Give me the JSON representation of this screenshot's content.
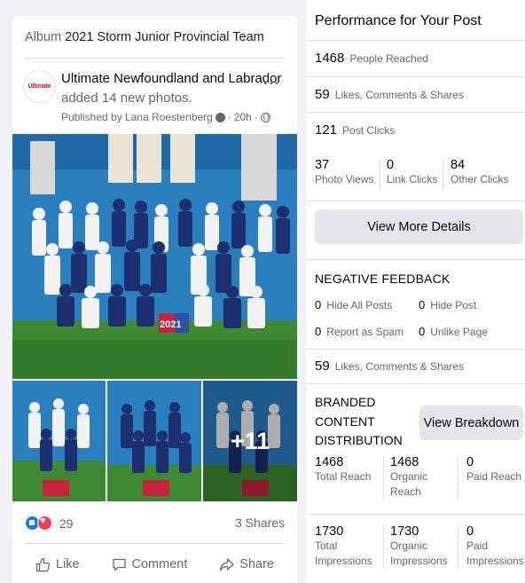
{
  "post": {
    "album_prefix": "Album",
    "album_name": "2021 Storm Junior Provincial Team",
    "avatar_text": "Ultimate",
    "page_name": "Ultimate Newfoundland and Labrador",
    "action_text": "added 14 new photos.",
    "published_by": "Published by Lana Roestenberg",
    "time": "20h",
    "more_photos": "+11",
    "reaction_count": "29",
    "shares": "3 Shares",
    "actions": {
      "like": "Like",
      "comment": "Comment",
      "share": "Share"
    },
    "colors": {
      "like": "#1877f2",
      "love": "#f33e58"
    }
  },
  "panel": {
    "title": "Performance for Your Post",
    "people_reached": {
      "value": "1468",
      "label": "People Reached"
    },
    "engagement": {
      "value": "59",
      "label": "Likes, Comments & Shares"
    },
    "post_clicks": {
      "value": "121",
      "label": "Post Clicks"
    },
    "clicks": [
      {
        "value": "37",
        "label": "Photo Views"
      },
      {
        "value": "0",
        "label": "Link Clicks"
      },
      {
        "value": "84",
        "label": "Other Clicks"
      }
    ],
    "view_details": "View More Details",
    "negative_feedback": {
      "title": "NEGATIVE FEEDBACK",
      "items": [
        {
          "value": "0",
          "label": "Hide All Posts"
        },
        {
          "value": "0",
          "label": "Hide Post"
        },
        {
          "value": "0",
          "label": "Report as Spam"
        },
        {
          "value": "0",
          "label": "Unlike Page"
        }
      ]
    },
    "engagement2": {
      "value": "59",
      "label": "Likes, Comments & Shares"
    },
    "branded": {
      "title_lines": [
        "BRANDED",
        "CONTENT",
        "DISTRIBUTION"
      ],
      "button": "View Breakdown",
      "reach": [
        {
          "value": "1468",
          "label": "Total Reach"
        },
        {
          "value": "1468",
          "label": "Organic Reach"
        },
        {
          "value": "0",
          "label": "Paid Reach"
        }
      ],
      "impressions": [
        {
          "value": "1730",
          "label": "Total Impressions"
        },
        {
          "value": "1730",
          "label": "Organic Impressions"
        },
        {
          "value": "0",
          "label": "Paid Impressions"
        }
      ]
    }
  }
}
